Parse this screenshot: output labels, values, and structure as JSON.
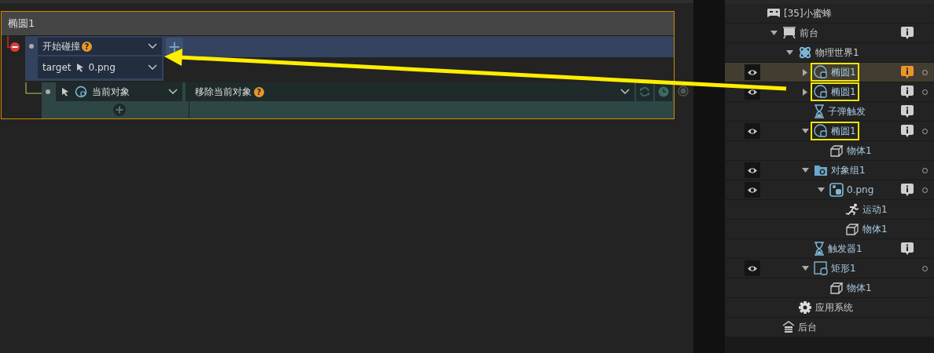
{
  "event": {
    "title": "椭圆1",
    "condition": {
      "label": "开始碰撞",
      "help": "?",
      "param_label": "target",
      "param_value": "0.png",
      "add": "+"
    },
    "action": {
      "object": "当前对象",
      "label": "移除当前对象",
      "help": "?"
    }
  },
  "tree": [
    {
      "label": "[35]小蜜蜂",
      "kind": "gamepad",
      "selected": false,
      "visible": false,
      "info": false,
      "dot": false,
      "boxed": false,
      "children": [
        {
          "label": "前台",
          "kind": "stage",
          "expanded": true,
          "selected": false,
          "visible": false,
          "info": true,
          "dot": false,
          "boxed": false,
          "children": [
            {
              "label": "物理世界1",
              "kind": "physics",
              "expanded": true,
              "selected": false,
              "visible": false,
              "info": false,
              "dot": false,
              "boxed": false,
              "children": [
                {
                  "label": "椭圆1",
                  "kind": "ellipse",
                  "expanded": false,
                  "selected": true,
                  "visible": true,
                  "info": true,
                  "dot": true,
                  "boxed": true
                },
                {
                  "label": "椭圆1",
                  "kind": "ellipse",
                  "expanded": false,
                  "selected": false,
                  "visible": true,
                  "info": true,
                  "dot": true,
                  "boxed": true
                },
                {
                  "label": "子弹触发",
                  "kind": "timer",
                  "selected": false,
                  "visible": false,
                  "info": true,
                  "dot": false,
                  "boxed": false
                },
                {
                  "label": "椭圆1",
                  "kind": "ellipse",
                  "expanded": true,
                  "selected": false,
                  "visible": true,
                  "info": true,
                  "dot": true,
                  "boxed": true,
                  "children": [
                    {
                      "label": "物体1",
                      "kind": "body",
                      "selected": false,
                      "visible": false,
                      "info": false,
                      "dot": false,
                      "boxed": false
                    }
                  ]
                },
                {
                  "label": "对象组1",
                  "kind": "group",
                  "expanded": true,
                  "selected": false,
                  "visible": true,
                  "info": false,
                  "dot": true,
                  "boxed": false,
                  "children": [
                    {
                      "label": "0.png",
                      "kind": "image",
                      "expanded": true,
                      "selected": false,
                      "visible": true,
                      "info": true,
                      "dot": true,
                      "boxed": false,
                      "children": [
                        {
                          "label": "运动1",
                          "kind": "motion",
                          "selected": false,
                          "visible": false,
                          "info": false,
                          "dot": false,
                          "boxed": false
                        },
                        {
                          "label": "物体1",
                          "kind": "body",
                          "selected": false,
                          "visible": false,
                          "info": false,
                          "dot": false,
                          "boxed": false
                        }
                      ]
                    }
                  ]
                },
                {
                  "label": "触发器1",
                  "kind": "timer",
                  "selected": false,
                  "visible": false,
                  "info": true,
                  "dot": false,
                  "boxed": false
                },
                {
                  "label": "矩形1",
                  "kind": "rect",
                  "expanded": true,
                  "selected": false,
                  "visible": true,
                  "info": false,
                  "dot": true,
                  "boxed": false,
                  "children": [
                    {
                      "label": "物体1",
                      "kind": "body",
                      "selected": false,
                      "visible": false,
                      "info": false,
                      "dot": false,
                      "boxed": false
                    }
                  ]
                }
              ]
            },
            {
              "label": "应用系统",
              "kind": "gear",
              "selected": false,
              "visible": false,
              "info": false,
              "dot": false,
              "boxed": false
            }
          ]
        },
        {
          "label": "后台",
          "kind": "backstage",
          "selected": false,
          "visible": false,
          "info": false,
          "dot": false,
          "boxed": false
        }
      ]
    }
  ]
}
